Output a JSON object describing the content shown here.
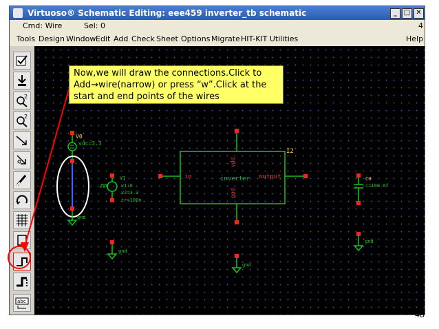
{
  "window": {
    "title": "Virtuoso® Schematic Editing: eee459 inverter_tb schematic",
    "buttons": [
      "_",
      "□",
      "✕"
    ]
  },
  "status": {
    "cmd": "Cmd: Wire",
    "sel": "Sel: 0",
    "count": "4"
  },
  "menu": [
    "Tools",
    "Design",
    "Window",
    "Edit",
    "Add",
    "Check",
    "Sheet",
    "Options",
    "Migrate",
    "HIT-KIT Utilities",
    "Help"
  ],
  "callout": {
    "text": "Now,we will draw the connections.Click to Add→wire(narrow) or press “w”.Click at the start and end points of the wires"
  },
  "schematic": {
    "vdc_name": "V0",
    "vdc_param": "vdc=3.3",
    "vpulse_name": "V1",
    "vpulse_params": [
      "v1:0",
      "v2=3.3",
      "tr=100n"
    ],
    "inverter_label": "inverter",
    "instance": "I2",
    "pin_in": "in",
    "pin_out": "output",
    "pin_vdd": "vdd",
    "pin_gnd": "gnd",
    "cap_name": "C0",
    "cap_param": "c=100.0f",
    "gnd_label": "gnd"
  },
  "page_number": "48",
  "colors": {
    "wire": "#4060ff",
    "pin": "#ff2020",
    "component": "#20c020",
    "annotation": "#ff0000"
  }
}
